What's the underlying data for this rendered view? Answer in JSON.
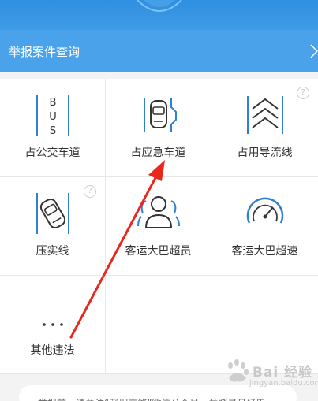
{
  "header": {
    "title": "举报案件查询"
  },
  "grid": {
    "items": [
      {
        "label": "占公交车道",
        "icon": "bus-lane-icon",
        "bus_letters": [
          "B",
          "U",
          "S"
        ],
        "help": false
      },
      {
        "label": "占应急车道",
        "icon": "emergency-lane-icon",
        "help": false
      },
      {
        "label": "占用导流线",
        "icon": "diversion-line-icon",
        "help": true
      },
      {
        "label": "压实线",
        "icon": "solid-line-icon",
        "help": true
      },
      {
        "label": "客运大巴超员",
        "icon": "passenger-overload-icon",
        "help": false
      },
      {
        "label": "客运大巴超速",
        "icon": "speedometer-icon",
        "help": false
      },
      {
        "label": "其他违法",
        "icon": "more-dots-icon",
        "help": false
      }
    ],
    "help_symbol": "?"
  },
  "footer": {
    "notice": "举报前，请关注“深圳交警”微信公众号，并登录且经用"
  },
  "watermark": {
    "brand": "Bai 经验",
    "url": "jingyan.baidu.com"
  },
  "colors": {
    "header_blue": "#4aa3ea",
    "icon_blue": "#2f7fd2",
    "annotation_red": "#e8271f"
  }
}
